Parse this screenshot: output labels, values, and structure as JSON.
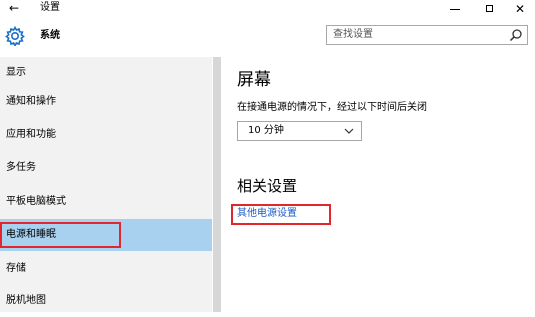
{
  "window": {
    "back_glyph": "←",
    "title": "设置",
    "min_label": "minimize",
    "max_label": "maximize",
    "close_glyph": "✕"
  },
  "header": {
    "section_title": "系统",
    "search_placeholder": "查找设置"
  },
  "sidebar": {
    "items": [
      {
        "label": "显示"
      },
      {
        "label": "通知和操作"
      },
      {
        "label": "应用和功能"
      },
      {
        "label": "多任务"
      },
      {
        "label": "平板电脑模式"
      },
      {
        "label": "电源和睡眠",
        "selected": true
      },
      {
        "label": "存储"
      },
      {
        "label": "脱机地图"
      }
    ]
  },
  "main": {
    "screen_heading": "屏幕",
    "screen_desc": "在接通电源的情况下，经过以下时间后关闭",
    "screen_timeout_value": "10 分钟",
    "related_heading": "相关设置",
    "related_link": "其他电源设置"
  },
  "colors": {
    "accent": "#a8d1f0",
    "link": "#1c5cc7",
    "annotation": "#e4252d",
    "sidebar_bg": "#f2f2f2"
  },
  "icons": [
    "back-arrow-icon",
    "gear-icon",
    "search-icon",
    "chevron-down-icon"
  ]
}
